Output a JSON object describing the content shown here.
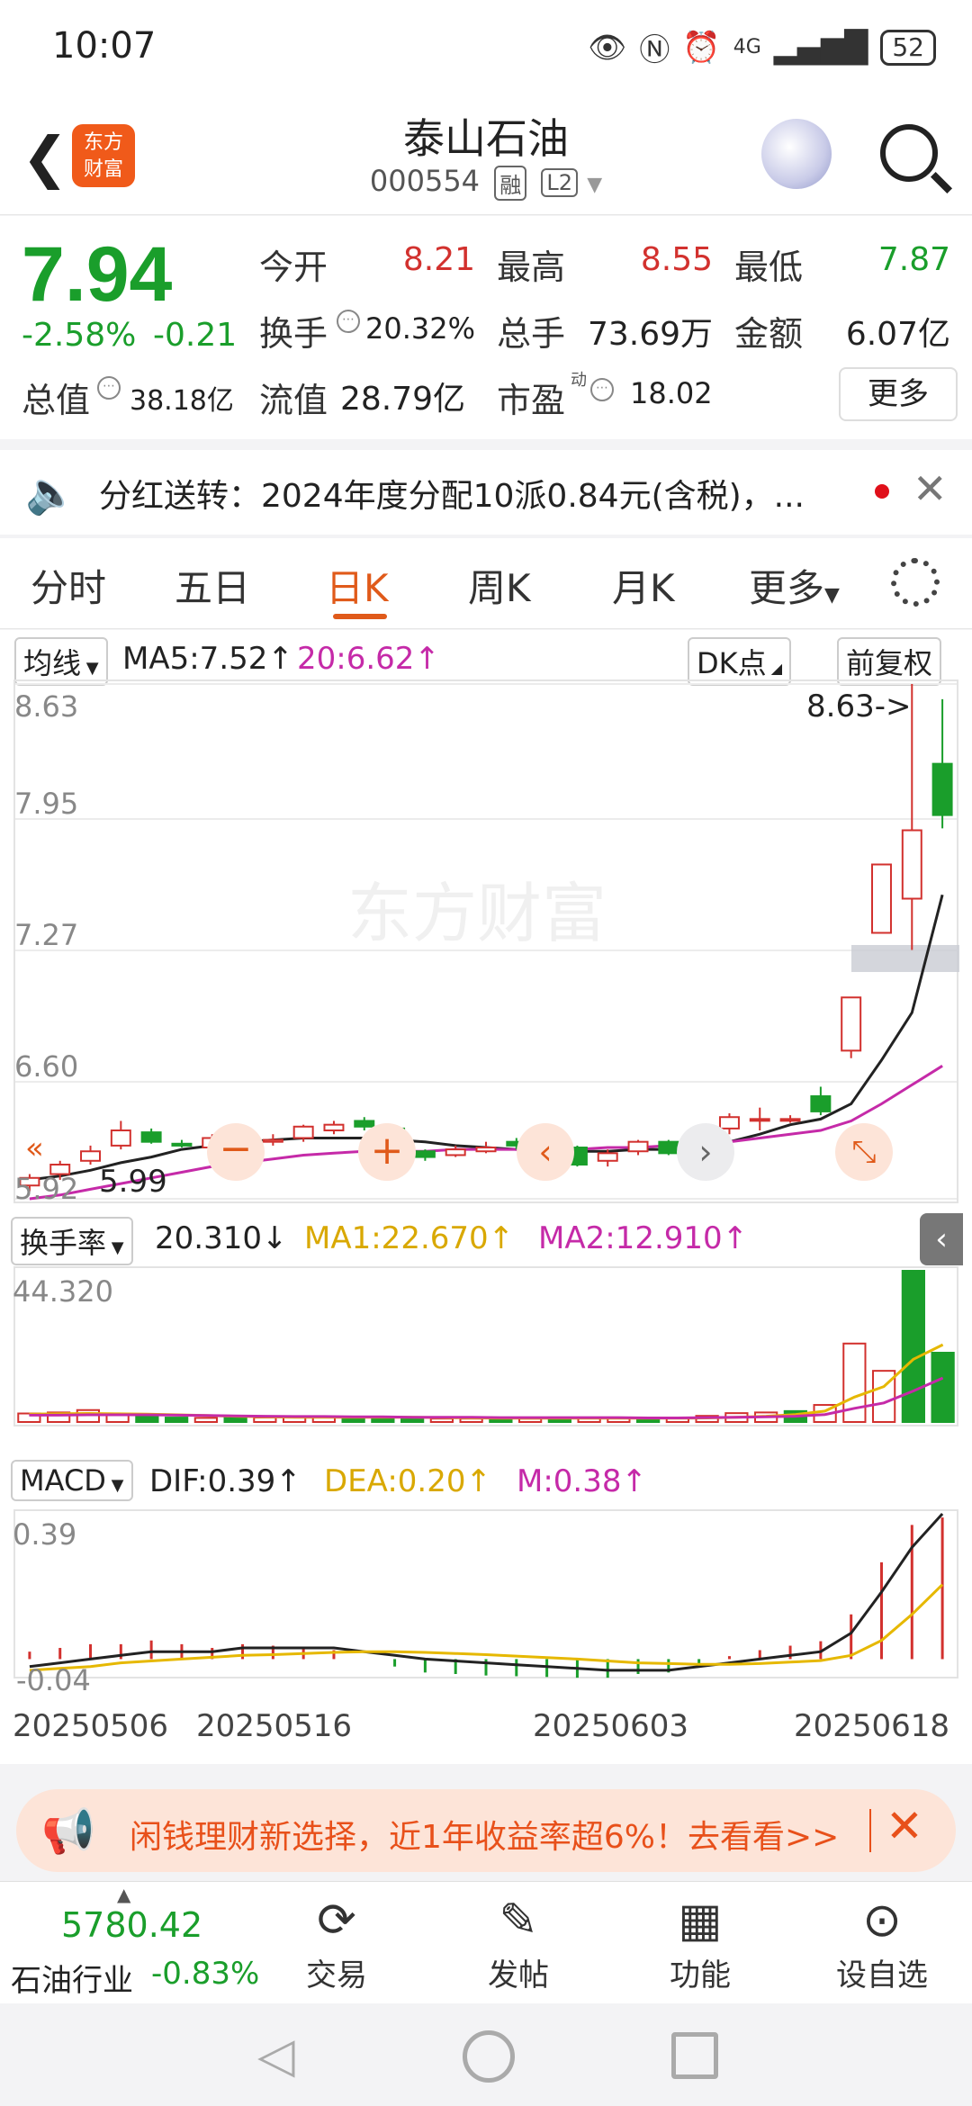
{
  "status": {
    "time": "10:07",
    "network": "4G",
    "battery": "52"
  },
  "header": {
    "logo_text": "东方\n财富",
    "stock_name": "泰山石油",
    "stock_code": "000554",
    "tag_margin": "融",
    "tag_level": "L2"
  },
  "quote": {
    "price": "7.94",
    "change_pct": "-2.58%",
    "change_val": "-0.21",
    "open_label": "今开",
    "open": "8.21",
    "high_label": "最高",
    "high": "8.55",
    "low_label": "最低",
    "low": "7.87",
    "turnover_label": "换手",
    "turnover": "20.32%",
    "volume_label": "总手",
    "volume": "73.69万",
    "amount_label": "金额",
    "amount": "6.07亿",
    "mktcap_label": "总值",
    "mktcap": "38.18亿",
    "float_label": "流值",
    "float_cap": "28.79亿",
    "pe_label": "市盈",
    "pe_sup": "动",
    "pe": "18.02",
    "more_label": "更多"
  },
  "notice": {
    "text": "分红送转：2024年度分配10派0.84元(含税)，..."
  },
  "tabs": [
    "分时",
    "五日",
    "日K",
    "周K",
    "月K",
    "更多"
  ],
  "active_tab": "日K",
  "kline": {
    "ma_selector": "均线",
    "ma5": "MA5:7.52↑",
    "ma20": "20:6.62↑",
    "dk_button": "DK点",
    "adjust_button": "前复权",
    "high_marker": "8.63->",
    "low_marker": "5.99",
    "y_labels": [
      "8.63",
      "7.95",
      "7.27",
      "6.60",
      "5.92"
    ],
    "watermark": "东方财富"
  },
  "turnover_panel": {
    "selector": "换手率",
    "value": "20.310↓",
    "ma1": "MA1:22.670↑",
    "ma2": "MA2:12.910↑",
    "y_max": "44.320"
  },
  "macd_panel": {
    "selector": "MACD",
    "dif": "DIF:0.39↑",
    "dea": "DEA:0.20↑",
    "m": "M:0.38↑",
    "y_max": "0.39",
    "y_min": "-0.04"
  },
  "x_axis": [
    "20250506",
    "20250516",
    "20250603",
    "20250618"
  ],
  "chart_data": {
    "type": "candlestick",
    "candles": [
      {
        "o": 5.99,
        "c": 6.03,
        "h": 6.05,
        "l": 5.96
      },
      {
        "o": 6.05,
        "c": 6.1,
        "h": 6.12,
        "l": 6.02
      },
      {
        "o": 6.12,
        "c": 6.17,
        "h": 6.2,
        "l": 6.1
      },
      {
        "o": 6.2,
        "c": 6.28,
        "h": 6.33,
        "l": 6.18
      },
      {
        "o": 6.27,
        "c": 6.22,
        "h": 6.29,
        "l": 6.21
      },
      {
        "o": 6.21,
        "c": 6.2,
        "h": 6.23,
        "l": 6.19
      },
      {
        "o": 6.19,
        "c": 6.24,
        "h": 6.26,
        "l": 6.16
      },
      {
        "o": 6.23,
        "c": 6.22,
        "h": 6.25,
        "l": 6.18
      },
      {
        "o": 6.22,
        "c": 6.23,
        "h": 6.26,
        "l": 6.2
      },
      {
        "o": 6.24,
        "c": 6.3,
        "h": 6.31,
        "l": 6.22
      },
      {
        "o": 6.28,
        "c": 6.31,
        "h": 6.33,
        "l": 6.26
      },
      {
        "o": 6.33,
        "c": 6.3,
        "h": 6.35,
        "l": 6.28
      },
      {
        "o": 6.29,
        "c": 6.17,
        "h": 6.3,
        "l": 6.16
      },
      {
        "o": 6.17,
        "c": 6.14,
        "h": 6.18,
        "l": 6.12
      },
      {
        "o": 6.15,
        "c": 6.18,
        "h": 6.2,
        "l": 6.14
      },
      {
        "o": 6.17,
        "c": 6.19,
        "h": 6.22,
        "l": 6.16
      },
      {
        "o": 6.22,
        "c": 6.2,
        "h": 6.24,
        "l": 6.18
      },
      {
        "o": 6.19,
        "c": 6.2,
        "h": 6.23,
        "l": 6.17
      },
      {
        "o": 6.19,
        "c": 6.1,
        "h": 6.2,
        "l": 6.09
      },
      {
        "o": 6.12,
        "c": 6.16,
        "h": 6.18,
        "l": 6.09
      },
      {
        "o": 6.17,
        "c": 6.22,
        "h": 6.23,
        "l": 6.15
      },
      {
        "o": 6.22,
        "c": 6.16,
        "h": 6.23,
        "l": 6.15
      },
      {
        "o": 6.19,
        "c": 6.26,
        "h": 6.27,
        "l": 6.17
      },
      {
        "o": 6.29,
        "c": 6.35,
        "h": 6.37,
        "l": 6.26
      },
      {
        "o": 6.34,
        "c": 6.34,
        "h": 6.4,
        "l": 6.28
      },
      {
        "o": 6.34,
        "c": 6.34,
        "h": 6.36,
        "l": 6.32
      },
      {
        "o": 6.46,
        "c": 6.38,
        "h": 6.51,
        "l": 6.36
      },
      {
        "o": 6.7,
        "c": 6.98,
        "h": 6.98,
        "l": 6.66
      },
      {
        "o": 7.32,
        "c": 7.68,
        "h": 7.68,
        "l": 7.32
      },
      {
        "o": 7.5,
        "c": 7.86,
        "h": 8.63,
        "l": 7.23
      },
      {
        "o": 8.21,
        "c": 7.94,
        "h": 8.55,
        "l": 7.87
      }
    ],
    "ma5": [
      6.02,
      6.04,
      6.07,
      6.11,
      6.14,
      6.18,
      6.2,
      6.22,
      6.23,
      6.24,
      6.24,
      6.24,
      6.23,
      6.22,
      6.2,
      6.19,
      6.18,
      6.18,
      6.17,
      6.17,
      6.18,
      6.18,
      6.19,
      6.22,
      6.26,
      6.31,
      6.34,
      6.42,
      6.65,
      6.9,
      7.52
    ],
    "ma20": [
      5.92,
      5.94,
      5.97,
      6.0,
      6.03,
      6.06,
      6.09,
      6.11,
      6.13,
      6.15,
      6.16,
      6.17,
      6.17,
      6.17,
      6.18,
      6.18,
      6.18,
      6.18,
      6.18,
      6.19,
      6.19,
      6.2,
      6.21,
      6.22,
      6.24,
      6.26,
      6.28,
      6.33,
      6.42,
      6.52,
      6.62
    ],
    "turnover": [
      2.5,
      2.8,
      3.5,
      2.0,
      1.5,
      1.3,
      1.2,
      1.4,
      1.3,
      1.5,
      1.6,
      1.4,
      1.2,
      1.1,
      1.0,
      1.0,
      1.1,
      1.0,
      1.2,
      1.1,
      1.1,
      1.0,
      1.2,
      1.8,
      2.6,
      2.8,
      3.2,
      5.0,
      23.0,
      15.0,
      44.32,
      20.31
    ],
    "turnover_ma1": [
      2.3,
      2.4,
      2.5,
      2.4,
      2.3,
      2.1,
      1.9,
      1.7,
      1.5,
      1.4,
      1.4,
      1.4,
      1.4,
      1.4,
      1.3,
      1.2,
      1.1,
      1.1,
      1.1,
      1.1,
      1.1,
      1.1,
      1.1,
      1.2,
      1.4,
      1.7,
      2.2,
      3.2,
      7.3,
      10.4,
      18.4,
      22.67
    ],
    "turnover_ma2": [
      2.0,
      2.0,
      2.1,
      2.1,
      2.1,
      2.0,
      1.9,
      1.8,
      1.7,
      1.6,
      1.6,
      1.5,
      1.5,
      1.4,
      1.4,
      1.4,
      1.3,
      1.3,
      1.3,
      1.3,
      1.3,
      1.2,
      1.2,
      1.3,
      1.4,
      1.5,
      1.7,
      2.2,
      4.0,
      5.6,
      9.1,
      12.91
    ],
    "macd": {
      "dif": [
        -0.02,
        -0.01,
        0.0,
        0.01,
        0.02,
        0.02,
        0.02,
        0.03,
        0.03,
        0.03,
        0.03,
        0.02,
        0.01,
        0.0,
        -0.005,
        -0.01,
        -0.015,
        -0.02,
        -0.025,
        -0.03,
        -0.03,
        -0.03,
        -0.02,
        -0.01,
        0.0,
        0.01,
        0.02,
        0.07,
        0.18,
        0.3,
        0.39
      ],
      "dea": [
        -0.03,
        -0.025,
        -0.02,
        -0.01,
        -0.005,
        0.0,
        0.005,
        0.01,
        0.012,
        0.015,
        0.018,
        0.02,
        0.02,
        0.018,
        0.015,
        0.012,
        0.008,
        0.004,
        0.0,
        -0.005,
        -0.01,
        -0.012,
        -0.014,
        -0.014,
        -0.012,
        -0.008,
        -0.004,
        0.01,
        0.05,
        0.12,
        0.2
      ],
      "m": [
        0.02,
        0.03,
        0.04,
        0.04,
        0.05,
        0.04,
        0.03,
        0.04,
        0.036,
        0.03,
        0.024,
        0.0,
        -0.02,
        -0.036,
        -0.04,
        -0.044,
        -0.046,
        -0.048,
        -0.05,
        -0.05,
        -0.04,
        -0.036,
        -0.012,
        0.008,
        0.024,
        0.036,
        0.048,
        0.12,
        0.26,
        0.36,
        0.38
      ]
    },
    "price_range": [
      5.92,
      8.63
    ],
    "turnover_max": 44.32,
    "macd_range": [
      -0.04,
      0.39
    ]
  },
  "promo": {
    "text": "闲钱理财新选择，近1年收益率超6%！去看看>>"
  },
  "bottom": {
    "index_value": "5780.42",
    "index_name": "石油行业",
    "index_change": "-0.83%",
    "nav": [
      {
        "icon": "trade-icon",
        "label": "交易"
      },
      {
        "icon": "post-icon",
        "label": "发帖"
      },
      {
        "icon": "function-icon",
        "label": "功能"
      },
      {
        "icon": "watchlist-icon",
        "label": "设自选"
      }
    ]
  },
  "colors": {
    "up": "#d2312e",
    "down": "#1a9e2b",
    "ma5": "#222222",
    "ma20": "#c52aa8",
    "ma1": "#e6b800",
    "accent": "#e05a1a"
  }
}
